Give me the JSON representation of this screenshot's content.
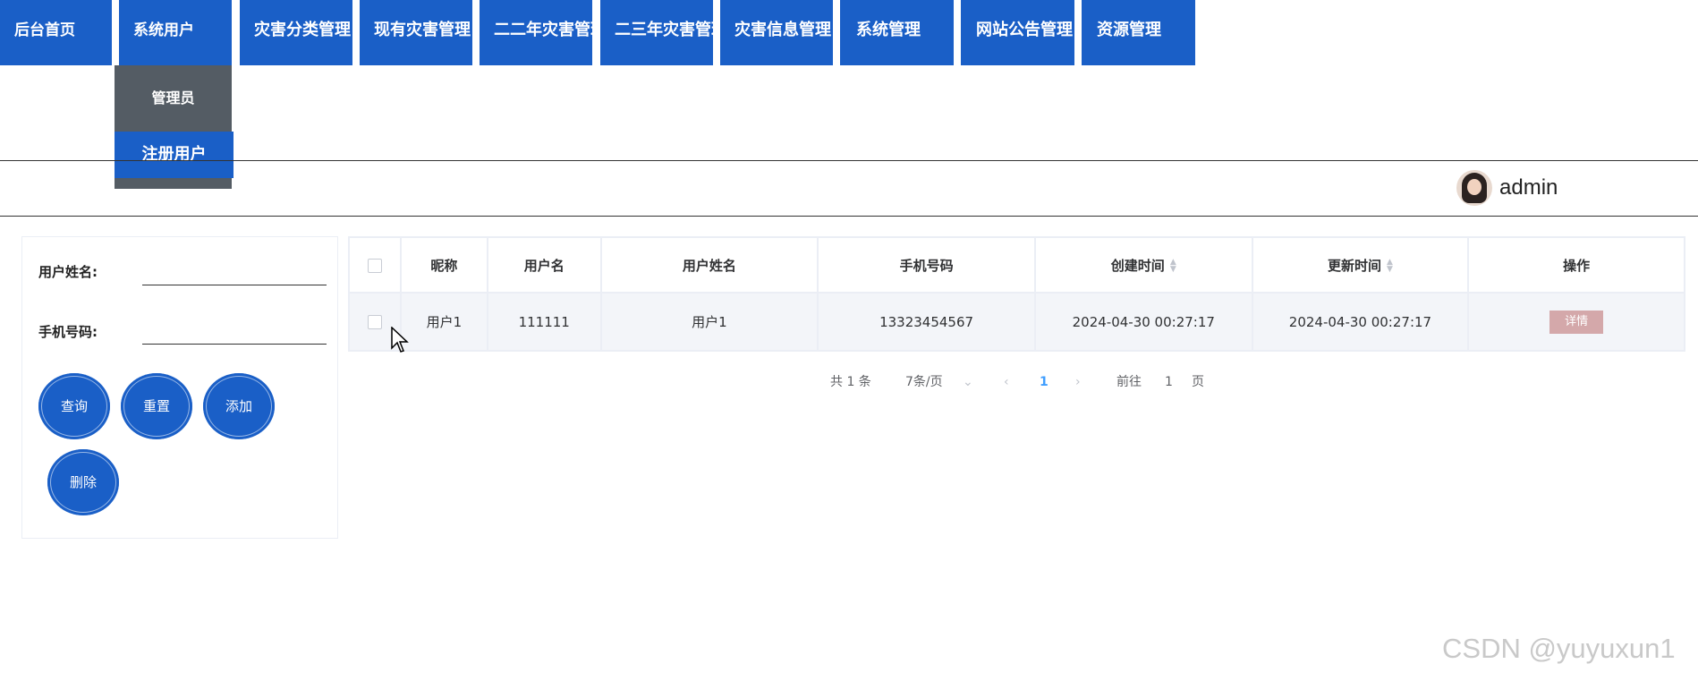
{
  "nav": {
    "items": [
      {
        "label": "后台首页"
      },
      {
        "label": "系统用户"
      },
      {
        "label": "灾害分类管理"
      },
      {
        "label": "现有灾害管理"
      },
      {
        "label": "二二年灾害管理"
      },
      {
        "label": "二三年灾害管理"
      },
      {
        "label": "灾害信息管理"
      },
      {
        "label": "系统管理"
      },
      {
        "label": "网站公告管理"
      },
      {
        "label": "资源管理"
      }
    ],
    "dropdown": {
      "items": [
        "管理员",
        "注册用户"
      ],
      "selected": "注册用户"
    }
  },
  "header": {
    "username": "admin"
  },
  "search": {
    "name_label": "用户姓名:",
    "name_value": "",
    "phone_label": "手机号码:",
    "phone_value": "",
    "buttons": {
      "query": "查询",
      "reset": "重置",
      "add": "添加",
      "delete": "删除"
    }
  },
  "table": {
    "columns": [
      "昵称",
      "用户名",
      "用户姓名",
      "手机号码",
      "创建时间",
      "更新时间",
      "操作"
    ],
    "rows": [
      {
        "nickname": "用户1",
        "username": "111111",
        "realname": "用户1",
        "phone": "13323454567",
        "created": "2024-04-30 00:27:17",
        "updated": "2024-04-30 00:27:17",
        "action": "详情"
      }
    ]
  },
  "pagination": {
    "total": "共 1 条",
    "page_size": "7条/页",
    "current": "1",
    "goto_label": "前往",
    "goto_value": "1",
    "goto_suffix": "页"
  },
  "watermark": "CSDN @yuyuxun1",
  "colors": {
    "nav_bg": "#1a5fc7",
    "dropdown_bg": "#545c64",
    "detail_btn": "#d4a8aa",
    "active_page": "#409eff"
  }
}
